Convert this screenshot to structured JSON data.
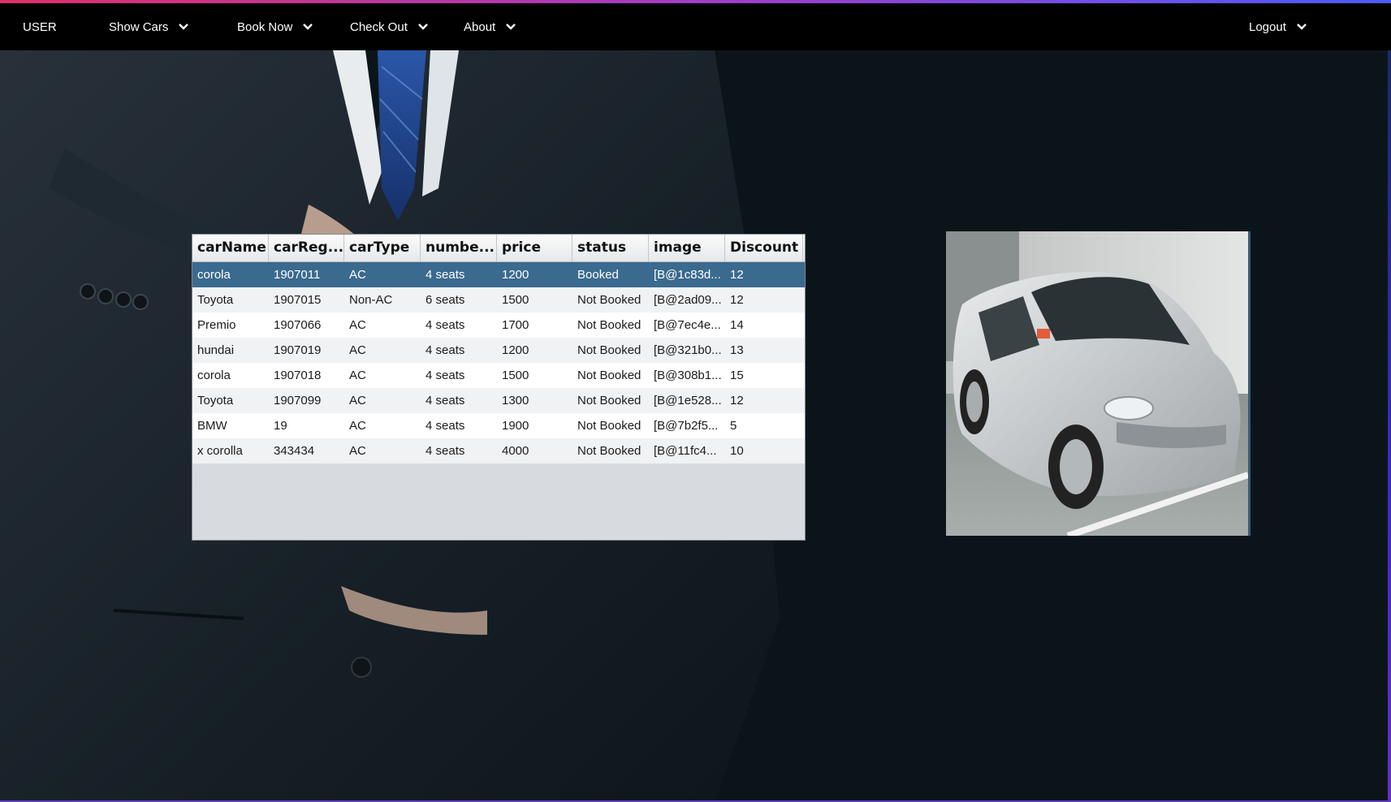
{
  "nav": {
    "user": "USER",
    "show_cars": "Show Cars",
    "book_now": "Book Now",
    "check_out": "Check Out",
    "about": "About",
    "logout": "Logout"
  },
  "table": {
    "columns": [
      "carName",
      "carReg...",
      "carType",
      "numbe...",
      "price",
      "status",
      "image",
      "Discount"
    ],
    "selected_row": 0,
    "rows": [
      [
        "corola",
        "1907011",
        "AC",
        "4 seats",
        "1200",
        "Booked",
        "[B@1c83d...",
        "12"
      ],
      [
        "Toyota",
        "1907015",
        "Non-AC",
        "6 seats",
        "1500",
        "Not Booked",
        "[B@2ad09...",
        "12"
      ],
      [
        "Premio",
        "1907066",
        "AC",
        "4 seats",
        "1700",
        "Not Booked",
        "[B@7ec4e...",
        "14"
      ],
      [
        "hundai",
        "1907019",
        "AC",
        "4 seats",
        "1200",
        "Not Booked",
        "[B@321b0...",
        "13"
      ],
      [
        "corola",
        "1907018",
        "AC",
        "4 seats",
        "1500",
        "Not Booked",
        "[B@308b1...",
        "15"
      ],
      [
        "Toyota",
        "1907099",
        "AC",
        "4 seats",
        "1300",
        "Not Booked",
        "[B@1e528...",
        "12"
      ],
      [
        "BMW",
        "19",
        "AC",
        "4 seats",
        "1900",
        "Not Booked",
        "[B@7b2f5...",
        "5"
      ],
      [
        "x corolla",
        "343434",
        "AC",
        "4 seats",
        "4000",
        "Not Booked",
        "[B@11fc4...",
        "10"
      ]
    ]
  },
  "colors": {
    "navbar": "#000000",
    "background": "#0b1519",
    "selected_row": "#3a6a8e",
    "accent_line": "#9b3fd0"
  },
  "icons": {
    "dropdown": "chevron-down-icon",
    "background_image": "businessman-suit-image",
    "car_image": "silver-sedan-image"
  }
}
